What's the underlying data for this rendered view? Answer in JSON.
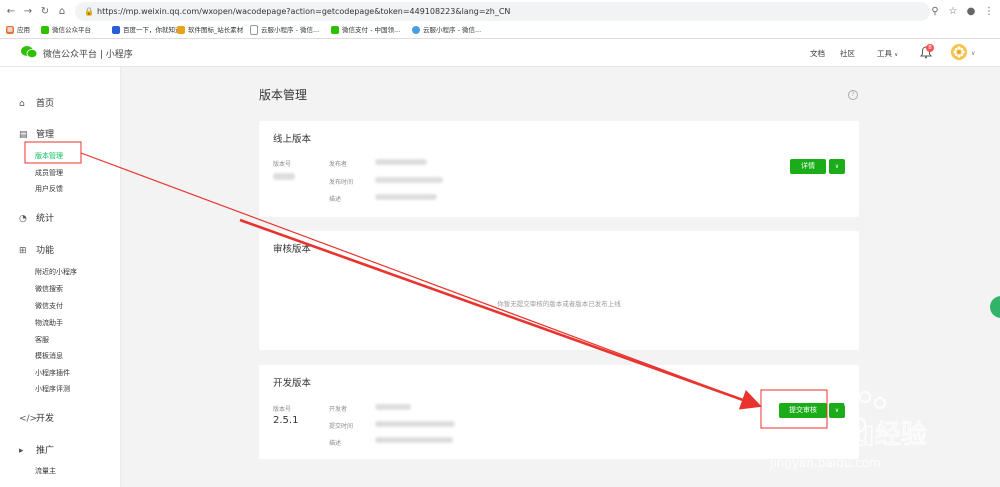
{
  "browser": {
    "url": "https://mp.weixin.qq.com/wxopen/wacodepage?action=getcodepage&token=449108223&lang=zh_CN",
    "bookmarks": [
      "应用",
      "微信公众平台",
      "百度一下，你就知道",
      "软件图标_站长素材",
      "云服小程序 - 微信...",
      "微信支付 - 中国领...",
      "云服小程序 - 微信..."
    ]
  },
  "header": {
    "title": "微信公众平台 | 小程序",
    "links": [
      "文档",
      "社区",
      "工具"
    ],
    "notification_count": "8"
  },
  "sidebar": {
    "sections": [
      {
        "label": "首页",
        "icon": "home-icon"
      },
      {
        "label": "管理",
        "icon": "monitor-icon",
        "items": [
          "版本管理",
          "成员管理",
          "用户反馈"
        ]
      },
      {
        "label": "统计",
        "icon": "pie-chart-icon"
      },
      {
        "label": "功能",
        "icon": "grid-icon",
        "items": [
          "附近的小程序",
          "微信搜索",
          "微信支付",
          "物流助手",
          "客服",
          "模板消息",
          "小程序插件",
          "小程序评测"
        ]
      },
      {
        "label": "开发",
        "icon": "code-icon"
      },
      {
        "label": "推广",
        "icon": "megaphone-icon",
        "items": [
          "流量主"
        ]
      }
    ],
    "active_item": "版本管理"
  },
  "main": {
    "title": "版本管理",
    "online": {
      "title": "线上版本",
      "version_label": "版本号",
      "publisher_label": "发布者",
      "publish_time_label": "发布时间",
      "desc_label": "描述",
      "detail_button": "详情"
    },
    "review": {
      "title": "审核版本",
      "empty_text": "你暂无提交审核的版本或者版本已发布上线"
    },
    "dev": {
      "title": "开发版本",
      "version_label": "版本号",
      "version": "2.5.1",
      "developer_label": "开发者",
      "submit_time_label": "提交时间",
      "desc_label": "描述",
      "submit_button": "提交审核"
    }
  },
  "watermark": {
    "text": "Baidu经验",
    "url": "jingyan.baidu.com"
  },
  "colors": {
    "accent": "#1aad19",
    "annotation": "#e8332e"
  }
}
